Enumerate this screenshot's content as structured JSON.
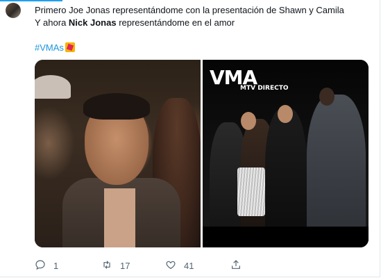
{
  "tweet": {
    "lines": [
      "Primero Joe Jonas representándome con la presentación de Shawn y Camila",
      "representándome en el amor"
    ],
    "line2_prefix": "Y ahora ",
    "line2_bold": "Nick Jonas",
    "line2_suffix": " representándome en el amor",
    "hashtag": "#VMAs",
    "hashtag_emoji": "vma-moonperson-emoji"
  },
  "media": {
    "left_photo": "photo-joe-jonas-audience",
    "right_photo": "photo-nick-jonas-stage",
    "logo_text": "VMA",
    "logo_sub": "MTV DIRECTO"
  },
  "actions": {
    "reply": {
      "icon": "reply-icon",
      "count": "1"
    },
    "retweet": {
      "icon": "retweet-icon",
      "count": "17"
    },
    "like": {
      "icon": "heart-icon",
      "count": "41"
    },
    "share": {
      "icon": "share-icon",
      "count": ""
    }
  },
  "colors": {
    "text": "#0f1419",
    "link": "#1b95e0",
    "muted": "#536471",
    "accent": "#1da1f2"
  }
}
